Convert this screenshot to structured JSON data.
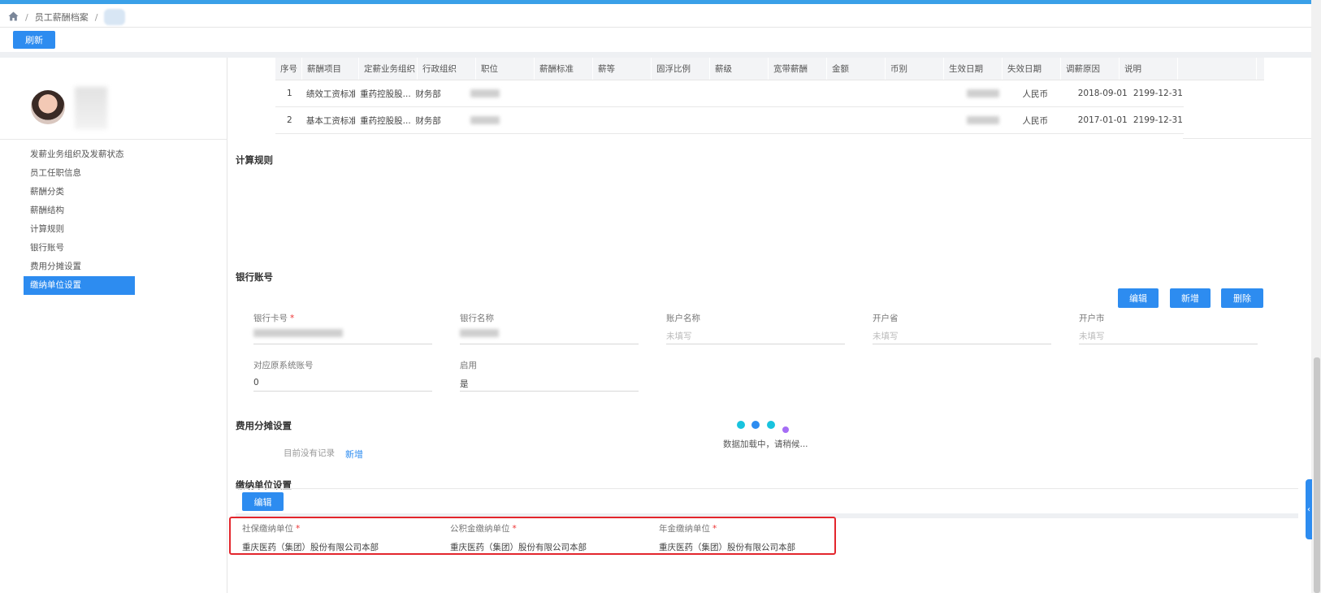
{
  "breadcrumb": {
    "items": [
      "员工薪酬档案"
    ]
  },
  "toolbar": {
    "refresh_label": "刷新"
  },
  "sidebar": {
    "items": [
      "发薪业务组织及发薪状态",
      "员工任职信息",
      "薪酬分类",
      "薪酬结构",
      "计算规则",
      "银行账号",
      "费用分摊设置",
      "缴纳单位设置"
    ],
    "active_index": 7
  },
  "salary_table": {
    "headers": [
      "序号",
      "薪酬项目",
      "定薪业务组织",
      "行政组织",
      "职位",
      "薪酬标准",
      "薪等",
      "固浮比例",
      "薪级",
      "宽带薪酬",
      "金额",
      "币别",
      "生效日期",
      "失效日期",
      "调薪原因",
      "说明"
    ],
    "rows": [
      [
        "1",
        "绩效工资标准",
        "重药控股股...",
        "财务部",
        "",
        "",
        "",
        "",
        "",
        "",
        "",
        "人民币",
        "2018-09-01",
        "2199-12-31",
        "",
        ""
      ],
      [
        "2",
        "基本工资标准",
        "重药控股股...",
        "财务部",
        "",
        "",
        "",
        "",
        "",
        "",
        "",
        "人民币",
        "2017-01-01",
        "2199-12-31",
        "",
        ""
      ]
    ]
  },
  "calc_rules": {
    "title": "计算规则"
  },
  "bank": {
    "title": "银行账号",
    "edit_label": "编辑",
    "add_label": "新增",
    "delete_label": "删除",
    "fields": {
      "card_label": "银行卡号",
      "bank_name_label": "银行名称",
      "account_name_label": "账户名称",
      "account_name_value": "未填写",
      "province_label": "开户省",
      "province_value": "未填写",
      "city_label": "开户市",
      "city_value": "未填写",
      "source_account_label": "对应原系统账号",
      "source_account_value": "0",
      "enabled_label": "启用",
      "enabled_value": "是"
    }
  },
  "cost_share": {
    "title": "费用分摊设置",
    "empty_text": "目前没有记录",
    "add_label": "新增",
    "loading_text": "数据加载中，请稍候..."
  },
  "payment_unit": {
    "title": "缴纳单位设置",
    "edit_label": "编辑",
    "social_label": "社保缴纳单位",
    "social_value": "重庆医药（集团）股份有限公司本部",
    "fund_label": "公积金缴纳单位",
    "fund_value": "重庆医药（集团）股份有限公司本部",
    "annuity_label": "年金缴纳单位",
    "annuity_value": "重庆医药（集团）股份有限公司本部"
  },
  "colors": {
    "primary": "#2d8cf0",
    "top_bar": "#3aa0e8",
    "highlight_box": "#e3262d"
  }
}
